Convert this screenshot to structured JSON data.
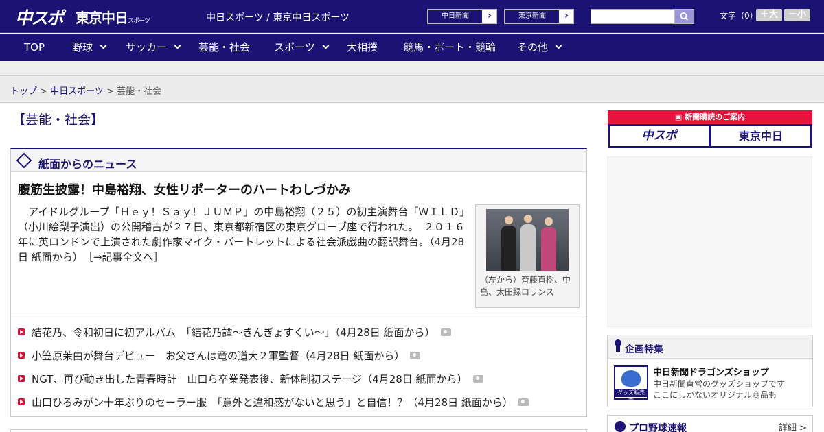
{
  "header": {
    "logo_chuspo": "中スポ",
    "logo_tokyo": "東京中日",
    "logo_tokyo_sub": "スポーツ",
    "site_names": "中日スポーツ / 東京中日スポーツ",
    "chunichi_btn": "中日新聞",
    "tokyo_btn": "東京新聞",
    "arrow": "›",
    "search_placeholder": "",
    "font_size_label": "文字（0）",
    "font_larger": "＋大",
    "font_smaller": "－小"
  },
  "nav": {
    "items": [
      {
        "label": "TOP"
      },
      {
        "label": "野球"
      },
      {
        "label": "サッカー"
      },
      {
        "label": "芸能・社会"
      },
      {
        "label": "スポーツ"
      },
      {
        "label": "大相撲"
      },
      {
        "label": "競馬・ボート・競輪"
      },
      {
        "label": "その他"
      }
    ]
  },
  "breadcrumb": {
    "home": "トップ",
    "sep": " > ",
    "section": "中日スポーツ",
    "current": "芸能・社会"
  },
  "page_title": "【芸能・社会】",
  "news": {
    "header": "紙面からのニュース",
    "headline": "腹筋生披露！中島裕翔、女性リポーターのハートわしづかみ",
    "lead": "　アイドルグループ「Ｈｅｙ！Ｓａｙ！ＪＵＭＰ」の中島裕翔（２５）の初主演舞台「ＷＩＬＤ」（小川絵梨子演出）の公開稽古が２７日、東京都新宿区の東京グローブ座で行われた。　２０１６年に英ロンドンで上演された劇作家マイク・バートレットによる社会派戯曲の翻訳舞台。（4月28日 紙面から）",
    "more": "［→記事全文へ］",
    "photo_caption": "（左から）斉藤直樹、中島、太田緑ロランス",
    "items": [
      {
        "title": "結花乃、令和初日に初アルバム　「結花乃譚～きんぎょすくい～」（4月28日 紙面から）"
      },
      {
        "title": "小笠原茉由が舞台デビュー　お父さんは竜の道大２軍監督（4月28日 紙面から）"
      },
      {
        "title": "NGT、再び動き出した青春時計　山口ら卒業発表後、新体制初ステージ（4月28日 紙面から）"
      },
      {
        "title": "山口ひろみがン十年ぶりのセーラー服　「意外と違和感がないと思う」と自信！？（4月28日 紙面から）"
      }
    ]
  },
  "sidebar": {
    "subscribe_title": "新聞購読のご案内",
    "sub_chuspo": "中スポ",
    "sub_tokyo": "東京中日",
    "feature_title": "企画特集",
    "shop_badge": "グッズ販売中",
    "shop_name": "中日新聞ドラゴンズショップ",
    "shop_desc1": "中日新聞直営のグッズショップです",
    "shop_desc2": "ここにしかないオリジナル商品も",
    "baseball_title": "プロ野球速報",
    "detail_link": "詳細 >"
  }
}
